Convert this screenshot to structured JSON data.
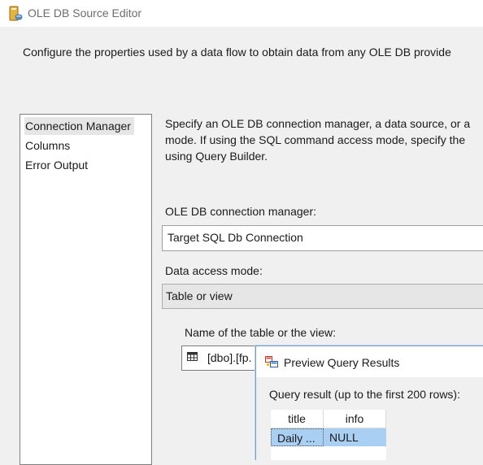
{
  "window": {
    "title": "OLE DB Source Editor",
    "description": "Configure the properties used by a data flow to obtain data from any OLE DB provide"
  },
  "nav": {
    "items": [
      {
        "label": "Connection Manager",
        "selected": true
      },
      {
        "label": "Columns",
        "selected": false
      },
      {
        "label": "Error Output",
        "selected": false
      }
    ]
  },
  "main": {
    "instructions": [
      "Specify an OLE DB connection manager, a data source, or a",
      "mode. If using the SQL command access mode, specify the",
      "using Query Builder."
    ],
    "connection_manager": {
      "label": "OLE DB connection manager:",
      "value": "Target SQL Db Connection"
    },
    "data_access_mode": {
      "label": "Data access mode:",
      "value": "Table or view"
    },
    "table_name": {
      "label": "Name of the table or the view:",
      "value": "[dbo].[fp."
    }
  },
  "preview": {
    "title": "Preview Query Results",
    "query_label": "Query result (up to the first 200 rows):",
    "columns": [
      "title",
      "info"
    ],
    "rows": [
      [
        "Daily ...",
        "NULL"
      ]
    ]
  },
  "colors": {
    "accent_selection": "#a9cff2",
    "window_bg": "#f0f0f0"
  }
}
